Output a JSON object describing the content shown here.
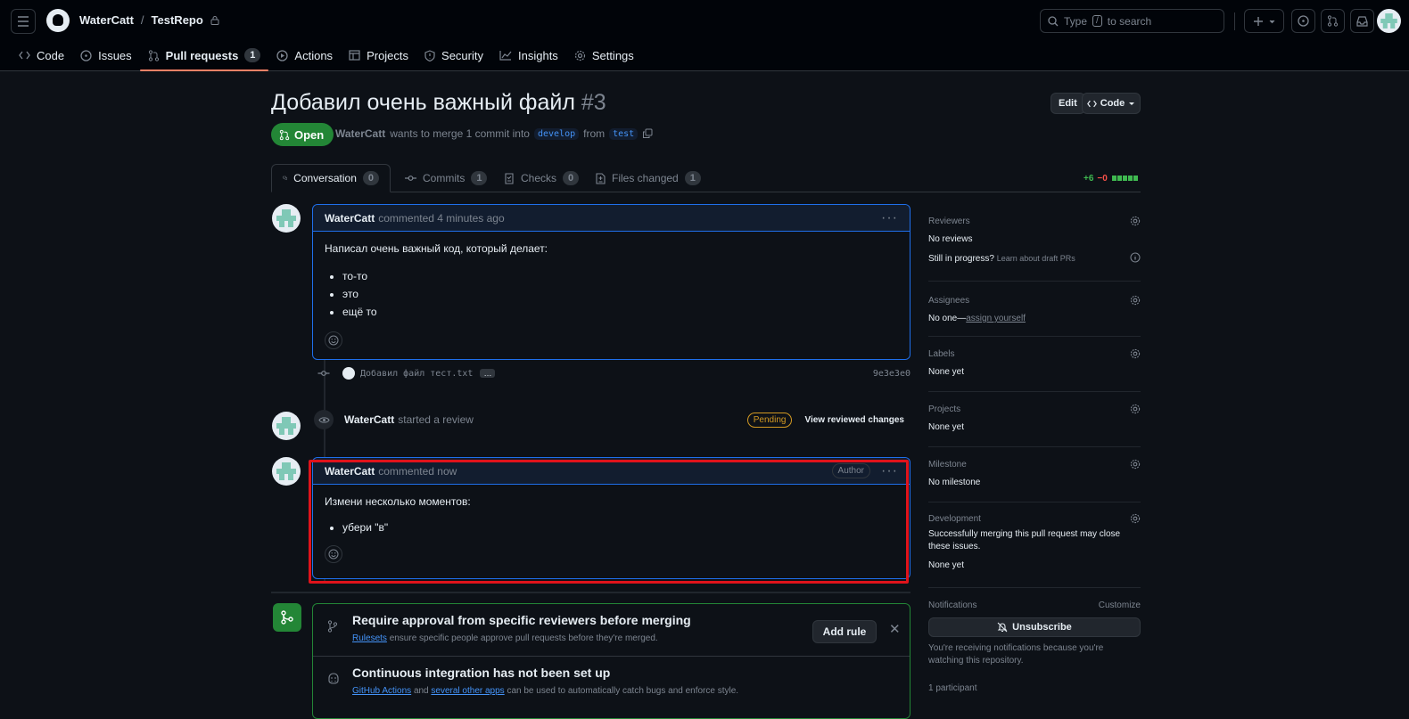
{
  "header": {
    "owner": "WaterCatt",
    "separator": "/",
    "repo": "TestRepo",
    "search_prefix": "Type",
    "search_key": "/",
    "search_suffix": "to search"
  },
  "repo_nav": [
    {
      "label": "Code",
      "icon": "code-icon"
    },
    {
      "label": "Issues",
      "icon": "issue-icon"
    },
    {
      "label": "Pull requests",
      "icon": "pr-icon",
      "count": "1",
      "active": true
    },
    {
      "label": "Actions",
      "icon": "play-icon"
    },
    {
      "label": "Projects",
      "icon": "table-icon"
    },
    {
      "label": "Security",
      "icon": "shield-icon"
    },
    {
      "label": "Insights",
      "icon": "graph-icon"
    },
    {
      "label": "Settings",
      "icon": "gear-icon"
    }
  ],
  "pr": {
    "title": "Добавил очень важный файл",
    "number": "#3",
    "edit_label": "Edit",
    "code_label": "Code",
    "state": "Open",
    "author": "WaterCatt",
    "meta_mid": "wants to merge 1 commit into",
    "base": "develop",
    "from_word": "from",
    "head": "test"
  },
  "tabs": [
    {
      "label": "Conversation",
      "count": "0",
      "icon": "comment-icon"
    },
    {
      "label": "Commits",
      "count": "1",
      "icon": "commit-icon"
    },
    {
      "label": "Checks",
      "count": "0",
      "icon": "checklist-icon"
    },
    {
      "label": "Files changed",
      "count": "1",
      "icon": "file-diff-icon"
    }
  ],
  "diffstat": {
    "added": "+6",
    "removed": "−0"
  },
  "comment1": {
    "author": "WaterCatt",
    "action": "commented 4 minutes ago",
    "text": "Написал очень важный код, который делает:",
    "items": [
      "то-то",
      "это",
      "ещё то"
    ]
  },
  "commit": {
    "message": "Добавил файл тест.txt",
    "ellipsis": "…",
    "sha": "9e3e3e0"
  },
  "review": {
    "author": "WaterCatt",
    "action": "started a review",
    "badge": "Pending",
    "view_label": "View reviewed changes"
  },
  "comment2": {
    "author": "WaterCatt",
    "action": "commented now",
    "badge": "Author",
    "text": "Измени несколько моментов:",
    "items": [
      "убери \"в\""
    ]
  },
  "merge_box": {
    "rule_title": "Require approval from specific reviewers before merging",
    "rule_link": "Rulesets",
    "rule_desc": "ensure specific people approve pull requests before they're merged.",
    "add_rule": "Add rule",
    "ci_title": "Continuous integration has not been set up",
    "ci_link1": "GitHub Actions",
    "ci_and": "and",
    "ci_link2": "several other apps",
    "ci_desc": "can be used to automatically catch bugs and enforce style."
  },
  "sidebar": {
    "reviewers_h": "Reviewers",
    "reviewers_v": "No reviews",
    "still_progress": "Still in progress?",
    "draft_link": "Learn about draft PRs",
    "assignees_h": "Assignees",
    "assignees_v": "No one—",
    "assign_link": "assign yourself",
    "labels_h": "Labels",
    "labels_v": "None yet",
    "projects_h": "Projects",
    "projects_v": "None yet",
    "milestone_h": "Milestone",
    "milestone_v": "No milestone",
    "development_h": "Development",
    "development_desc": "Successfully merging this pull request may close these issues.",
    "development_v": "None yet",
    "notifications_h": "Notifications",
    "customize": "Customize",
    "unsubscribe": "Unsubscribe",
    "notif_desc": "You're receiving notifications because you're watching this repository.",
    "participants": "1 participant"
  },
  "colors": {
    "accent_open": "#238636",
    "highlight": "#e0131b",
    "link": "#4493f8"
  }
}
